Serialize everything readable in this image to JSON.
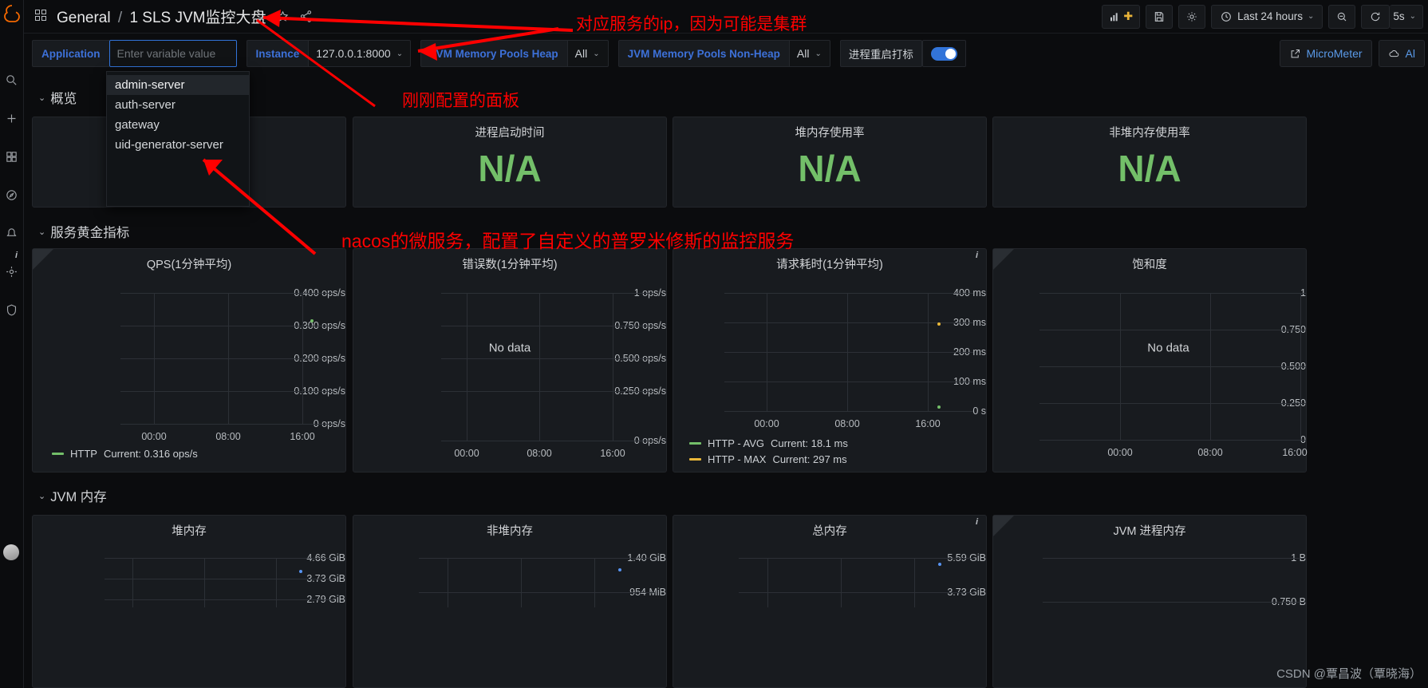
{
  "rail": {
    "logo_name": "grafana-logo",
    "items": [
      {
        "name": "search-icon"
      },
      {
        "name": "plus-icon"
      },
      {
        "name": "dashboards-icon"
      },
      {
        "name": "explore-icon"
      },
      {
        "name": "alerting-icon"
      },
      {
        "name": "config-icon"
      },
      {
        "name": "shield-icon"
      }
    ]
  },
  "header": {
    "folder": "General",
    "separator": "/",
    "title": "1 SLS JVM监控大盘",
    "star_icon": "star-icon",
    "share_icon": "share-icon",
    "toolbar": {
      "add_panel_label": "add-panel-icon",
      "save_label": "save-icon",
      "settings_label": "gear-icon",
      "time_range": "Last 24 hours",
      "zoom_out_label": "zoom-out-icon",
      "refresh_label": "refresh-icon",
      "refresh_interval": "5s"
    }
  },
  "variables": [
    {
      "label": "Application",
      "value": "Enter variable value",
      "is_placeholder": true,
      "has_chevron": false
    },
    {
      "label": "Instance",
      "value": "127.0.0.1:8000",
      "is_placeholder": false,
      "has_chevron": true
    },
    {
      "label": "JVM Memory Pools Heap",
      "value": "All",
      "is_placeholder": false,
      "has_chevron": true
    },
    {
      "label": "JVM Memory Pools Non-Heap",
      "value": "All",
      "is_placeholder": false,
      "has_chevron": true
    }
  ],
  "toggle_variable": {
    "label": "进程重启打标",
    "on": true
  },
  "links": [
    {
      "label": "MicroMeter",
      "icon": "external-link-icon"
    },
    {
      "label": "Al",
      "icon": "cloud-icon"
    }
  ],
  "dropdown": {
    "open": true,
    "options": [
      "admin-server",
      "auth-server",
      "gateway",
      "uid-generator-server"
    ],
    "highlighted_index": 0
  },
  "rows": [
    {
      "title": "概览"
    },
    {
      "title": "服务黄金指标"
    },
    {
      "title": "JVM 内存"
    }
  ],
  "overview_panels": [
    {
      "title": "",
      "value": "",
      "blank": true
    },
    {
      "title": "进程启动时间",
      "value": "N/A",
      "blank": false
    },
    {
      "title": "堆内存使用率",
      "value": "N/A",
      "blank": false
    },
    {
      "title": "非堆内存使用率",
      "value": "N/A",
      "blank": false
    }
  ],
  "colors": {
    "green": "#73bf69",
    "yellow": "#eab839",
    "blue": "#5794f2",
    "accent_blue": "#3274d9",
    "link_blue": "#3d71d9",
    "annotation_red": "#ff0000",
    "panel_bg": "#181b1f",
    "page_bg": "#0b0c0e"
  },
  "chart_data": [
    {
      "id": "qps",
      "type": "scatter",
      "title": "QPS(1分钟平均)",
      "has_info_corner": true,
      "ylabel": "",
      "xlabel": "",
      "yticks": [
        "0 ops/s",
        "0.100 ops/s",
        "0.200 ops/s",
        "0.300 ops/s",
        "0.400 ops/s"
      ],
      "yvalues": [
        0,
        0.1,
        0.2,
        0.3,
        0.4
      ],
      "ylim": [
        0,
        0.4
      ],
      "xticks": [
        "00:00",
        "08:00",
        "16:00"
      ],
      "grid": true,
      "points": [
        {
          "x": 0.87,
          "y": 0.316,
          "color": "#73bf69"
        }
      ],
      "legend": [
        {
          "name": "HTTP",
          "stat": "Current: 0.316 ops/s",
          "color": "#73bf69"
        }
      ],
      "no_data": false
    },
    {
      "id": "errors",
      "type": "scatter",
      "title": "错误数(1分钟平均)",
      "has_info_corner": false,
      "ylabel": "",
      "xlabel": "",
      "yticks": [
        "0 ops/s",
        "0.250 ops/s",
        "0.500 ops/s",
        "0.750 ops/s",
        "1 ops/s"
      ],
      "yvalues": [
        0,
        0.25,
        0.5,
        0.75,
        1
      ],
      "ylim": [
        0,
        1
      ],
      "xticks": [
        "00:00",
        "08:00",
        "16:00"
      ],
      "grid": true,
      "points": [],
      "legend": [],
      "no_data": true,
      "no_data_text": "No data"
    },
    {
      "id": "latency",
      "type": "scatter",
      "title": "请求耗时(1分钟平均)",
      "has_info_corner": false,
      "ylabel": "",
      "xlabel": "",
      "yticks": [
        "0 s",
        "100 ms",
        "200 ms",
        "300 ms",
        "400 ms"
      ],
      "yvalues": [
        0,
        100,
        200,
        300,
        400
      ],
      "ylim": [
        0,
        400
      ],
      "xticks": [
        "00:00",
        "08:00",
        "16:00"
      ],
      "grid": true,
      "points": [
        {
          "x": 0.86,
          "y": 297,
          "color": "#eab839"
        },
        {
          "x": 0.86,
          "y": 18.1,
          "color": "#73bf69"
        }
      ],
      "legend": [
        {
          "name": "HTTP - AVG",
          "stat": "Current: 18.1 ms",
          "color": "#73bf69"
        },
        {
          "name": "HTTP - MAX",
          "stat": "Current: 297 ms",
          "color": "#eab839"
        }
      ],
      "no_data": false
    },
    {
      "id": "saturation",
      "type": "scatter",
      "title": "饱和度",
      "has_info_corner": true,
      "ylabel": "",
      "xlabel": "",
      "yticks": [
        "0",
        "0.250",
        "0.500",
        "0.750",
        "1"
      ],
      "yvalues": [
        0,
        0.25,
        0.5,
        0.75,
        1
      ],
      "ylim": [
        0,
        1
      ],
      "xticks": [
        "00:00",
        "08:00",
        "16:00"
      ],
      "grid": true,
      "points": [],
      "legend": [],
      "no_data": true,
      "no_data_text": "No data"
    },
    {
      "id": "heap",
      "type": "scatter",
      "title": "堆内存",
      "has_info_corner": false,
      "yticks": [
        "2.79 GiB",
        "3.73 GiB",
        "4.66 GiB"
      ],
      "grid": true,
      "points": [
        {
          "x": 0.86,
          "y": 0.5,
          "color": "#5794f2"
        }
      ],
      "no_data": false
    },
    {
      "id": "nonheap",
      "type": "scatter",
      "title": "非堆内存",
      "has_info_corner": false,
      "yticks": [
        "954 MiB",
        "1.40 GiB"
      ],
      "grid": true,
      "points": [
        {
          "x": 0.86,
          "y": 0.62,
          "color": "#5794f2"
        }
      ],
      "no_data": false
    },
    {
      "id": "total",
      "type": "scatter",
      "title": "总内存",
      "has_info_corner": false,
      "yticks": [
        "3.73 GiB",
        "5.59 GiB"
      ],
      "grid": true,
      "points": [
        {
          "x": 0.86,
          "y": 0.86,
          "color": "#5794f2"
        }
      ],
      "no_data": false
    },
    {
      "id": "jvmproc",
      "type": "scatter",
      "title": "JVM 进程内存",
      "has_info_corner": true,
      "yticks": [
        "0.750 B",
        "1 B"
      ],
      "grid": true,
      "points": [],
      "no_data": false
    }
  ],
  "annotations": [
    {
      "id": "ip",
      "text": "对应服务的ip，因为可能是集群"
    },
    {
      "id": "panel",
      "text": "刚刚配置的面板"
    },
    {
      "id": "nacos",
      "text": "nacos的微服务，配置了自定义的普罗米修斯的监控服务"
    }
  ],
  "watermark": "CSDN @覃昌波（覃晓海）"
}
